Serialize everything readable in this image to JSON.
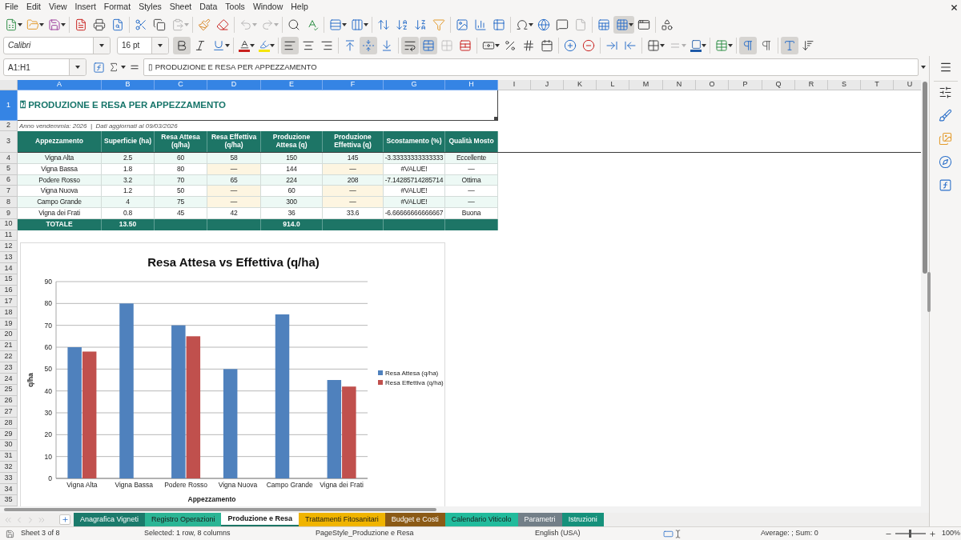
{
  "menu": [
    "File",
    "Edit",
    "View",
    "Insert",
    "Format",
    "Styles",
    "Sheet",
    "Data",
    "Tools",
    "Window",
    "Help"
  ],
  "toolbars": [
    {
      "groups": [
        [
          {
            "kind": "new",
            "dropdown": true,
            "pressed": false,
            "disabled": false
          },
          {
            "kind": "open",
            "dropdown": true,
            "pressed": false,
            "disabled": false
          },
          {
            "kind": "save",
            "dropdown": true,
            "pressed": false,
            "disabled": false
          }
        ],
        [
          {
            "kind": "export_pdf",
            "dropdown": false,
            "pressed": false,
            "disabled": false
          },
          {
            "kind": "print",
            "dropdown": false,
            "pressed": false,
            "disabled": false
          },
          {
            "kind": "print_preview",
            "dropdown": false,
            "pressed": false,
            "disabled": false
          }
        ],
        [
          {
            "kind": "cut",
            "dropdown": false,
            "pressed": false,
            "disabled": false
          },
          {
            "kind": "copy",
            "dropdown": false,
            "pressed": false,
            "disabled": false
          },
          {
            "kind": "paste",
            "dropdown": true,
            "pressed": false,
            "disabled": true
          }
        ],
        [
          {
            "kind": "clone_formatting",
            "dropdown": false,
            "pressed": false,
            "disabled": false
          },
          {
            "kind": "clear_formatting",
            "dropdown": false,
            "pressed": false,
            "disabled": false
          }
        ],
        [
          {
            "kind": "undo",
            "dropdown": true,
            "pressed": false,
            "disabled": true
          },
          {
            "kind": "redo",
            "dropdown": true,
            "pressed": false,
            "disabled": true
          }
        ],
        [
          {
            "kind": "find_replace",
            "dropdown": false,
            "pressed": false,
            "disabled": false
          },
          {
            "kind": "spelling",
            "dropdown": false,
            "pressed": false,
            "disabled": false
          }
        ],
        [
          {
            "kind": "row",
            "dropdown": true,
            "pressed": false,
            "disabled": false
          },
          {
            "kind": "column",
            "dropdown": true,
            "pressed": false,
            "disabled": false
          }
        ],
        [
          {
            "kind": "sort",
            "dropdown": false,
            "pressed": false,
            "disabled": false
          },
          {
            "kind": "sort_ascending",
            "dropdown": false,
            "pressed": false,
            "disabled": false
          },
          {
            "kind": "sort_descending",
            "dropdown": false,
            "pressed": false,
            "disabled": false
          },
          {
            "kind": "autofilter",
            "dropdown": false,
            "pressed": false,
            "disabled": false
          }
        ],
        [
          {
            "kind": "image",
            "dropdown": false,
            "pressed": false,
            "disabled": false
          },
          {
            "kind": "chart",
            "dropdown": false,
            "pressed": false,
            "disabled": false
          },
          {
            "kind": "pivot_table",
            "dropdown": false,
            "pressed": false,
            "disabled": false
          }
        ],
        [
          {
            "kind": "special_character",
            "dropdown": true,
            "pressed": false,
            "disabled": false
          },
          {
            "kind": "hyperlink",
            "dropdown": false,
            "pressed": false,
            "disabled": false
          },
          {
            "kind": "comment",
            "dropdown": false,
            "pressed": false,
            "disabled": false
          },
          {
            "kind": "header_footer",
            "dropdown": false,
            "pressed": false,
            "disabled": true
          }
        ],
        [
          {
            "kind": "print_area",
            "dropdown": false,
            "pressed": false,
            "disabled": false
          },
          {
            "kind": "freeze",
            "dropdown": true,
            "pressed": true,
            "disabled": false
          },
          {
            "kind": "split_window",
            "dropdown": false,
            "pressed": false,
            "disabled": false
          }
        ],
        [
          {
            "kind": "draw_functions",
            "dropdown": false,
            "pressed": false,
            "disabled": false
          }
        ]
      ]
    },
    {
      "font_name": "Calibri",
      "font_missing": true,
      "font_size": "16 pt",
      "groups": [
        [
          {
            "kind": "bold",
            "dropdown": false,
            "pressed": true,
            "disabled": false
          },
          {
            "kind": "italic",
            "dropdown": false,
            "pressed": false,
            "disabled": false
          },
          {
            "kind": "underline",
            "dropdown": true,
            "pressed": false,
            "disabled": false
          }
        ],
        [
          {
            "kind": "font_color",
            "dropdown": true,
            "pressed": false,
            "disabled": false
          },
          {
            "kind": "highlight",
            "dropdown": true,
            "pressed": false,
            "disabled": false
          }
        ],
        [
          {
            "kind": "align_left",
            "dropdown": false,
            "pressed": true,
            "disabled": false
          },
          {
            "kind": "align_center",
            "dropdown": false,
            "pressed": false,
            "disabled": false
          },
          {
            "kind": "align_right",
            "dropdown": false,
            "pressed": false,
            "disabled": false
          }
        ],
        [
          {
            "kind": "align_top",
            "dropdown": false,
            "pressed": false,
            "disabled": false
          },
          {
            "kind": "align_middle",
            "dropdown": false,
            "pressed": true,
            "disabled": false
          },
          {
            "kind": "align_bottom",
            "dropdown": false,
            "pressed": false,
            "disabled": false
          }
        ],
        [
          {
            "kind": "wrap_text",
            "dropdown": false,
            "pressed": true,
            "disabled": false
          },
          {
            "kind": "merge_center",
            "dropdown": false,
            "pressed": true,
            "disabled": false
          },
          {
            "kind": "merge_cells",
            "dropdown": false,
            "pressed": false,
            "disabled": true
          },
          {
            "kind": "unmerge_cells",
            "dropdown": false,
            "pressed": false,
            "disabled": false
          }
        ],
        [
          {
            "kind": "currency",
            "dropdown": true,
            "pressed": false,
            "disabled": false
          },
          {
            "kind": "percent",
            "dropdown": false,
            "pressed": false,
            "disabled": false
          },
          {
            "kind": "number",
            "dropdown": false,
            "pressed": false,
            "disabled": false
          },
          {
            "kind": "date",
            "dropdown": false,
            "pressed": false,
            "disabled": false
          }
        ],
        [
          {
            "kind": "add_decimal",
            "dropdown": false,
            "pressed": false,
            "disabled": false
          },
          {
            "kind": "delete_decimal",
            "dropdown": false,
            "pressed": false,
            "disabled": false
          }
        ],
        [
          {
            "kind": "indent",
            "dropdown": false,
            "pressed": false,
            "disabled": false
          },
          {
            "kind": "outdent",
            "dropdown": false,
            "pressed": false,
            "disabled": false
          }
        ],
        [
          {
            "kind": "borders",
            "dropdown": true,
            "pressed": false,
            "disabled": false
          },
          {
            "kind": "border_style",
            "dropdown": true,
            "pressed": false,
            "disabled": true
          },
          {
            "kind": "border_color",
            "dropdown": true,
            "pressed": false,
            "disabled": false
          }
        ],
        [
          {
            "kind": "conditional",
            "dropdown": true,
            "pressed": false,
            "disabled": false
          }
        ],
        [
          {
            "kind": "left_to_right",
            "dropdown": false,
            "pressed": true,
            "disabled": false
          },
          {
            "kind": "right_to_left",
            "dropdown": false,
            "pressed": false,
            "disabled": false
          }
        ],
        [
          {
            "kind": "text_orientation",
            "dropdown": false,
            "pressed": true,
            "disabled": false
          },
          {
            "kind": "vertical_text",
            "dropdown": false,
            "pressed": false,
            "disabled": false
          }
        ]
      ]
    }
  ],
  "formula_bar": {
    "name_box": "A1:H1",
    "formula": "▯ PRODUZIONE E RESA PER APPEZZAMENTO"
  },
  "sheet": {
    "columns": [
      {
        "label": "A",
        "selected": true
      },
      {
        "label": "B",
        "selected": true
      },
      {
        "label": "C",
        "selected": true
      },
      {
        "label": "D",
        "selected": true
      },
      {
        "label": "E",
        "selected": true
      },
      {
        "label": "F",
        "selected": true
      },
      {
        "label": "G",
        "selected": true
      },
      {
        "label": "H",
        "selected": true
      },
      {
        "label": "I",
        "selected": false
      },
      {
        "label": "J",
        "selected": false
      },
      {
        "label": "K",
        "selected": false
      },
      {
        "label": "L",
        "selected": false
      },
      {
        "label": "M",
        "selected": false
      },
      {
        "label": "N",
        "selected": false
      },
      {
        "label": "O",
        "selected": false
      },
      {
        "label": "P",
        "selected": false
      },
      {
        "label": "Q",
        "selected": false
      },
      {
        "label": "R",
        "selected": false
      },
      {
        "label": "S",
        "selected": false
      },
      {
        "label": "T",
        "selected": false
      },
      {
        "label": "U",
        "selected": false
      }
    ],
    "rows": [
      {
        "label": "1",
        "selected": true
      },
      {
        "label": "2",
        "selected": false
      },
      {
        "label": "3",
        "selected": false
      },
      {
        "label": "4",
        "selected": false
      },
      {
        "label": "5",
        "selected": false
      },
      {
        "label": "6",
        "selected": false
      },
      {
        "label": "7",
        "selected": false
      },
      {
        "label": "8",
        "selected": false
      },
      {
        "label": "9",
        "selected": false
      },
      {
        "label": "10",
        "selected": false
      },
      {
        "label": "11",
        "selected": false
      },
      {
        "label": "12",
        "selected": false
      },
      {
        "label": "13",
        "selected": false
      },
      {
        "label": "14",
        "selected": false
      },
      {
        "label": "15",
        "selected": false
      },
      {
        "label": "16",
        "selected": false
      },
      {
        "label": "17",
        "selected": false
      },
      {
        "label": "18",
        "selected": false
      },
      {
        "label": "19",
        "selected": false
      },
      {
        "label": "20",
        "selected": false
      },
      {
        "label": "21",
        "selected": false
      },
      {
        "label": "22",
        "selected": false
      },
      {
        "label": "23",
        "selected": false
      },
      {
        "label": "24",
        "selected": false
      },
      {
        "label": "25",
        "selected": false
      },
      {
        "label": "26",
        "selected": false
      },
      {
        "label": "27",
        "selected": false
      },
      {
        "label": "28",
        "selected": false
      },
      {
        "label": "29",
        "selected": false
      },
      {
        "label": "30",
        "selected": false
      },
      {
        "label": "31",
        "selected": false
      },
      {
        "label": "32",
        "selected": false
      },
      {
        "label": "33",
        "selected": false
      },
      {
        "label": "34",
        "selected": false
      },
      {
        "label": "35",
        "selected": false
      }
    ],
    "title": "⍰ PRODUZIONE E RESA PER APPEZZAMENTO",
    "subtitle": "Anno vendemmia: 2026  |  Dati aggiornati al 09/03/2026",
    "table": {
      "columns": [
        "Appezzamento",
        "Superficie (ha)",
        "Resa Attesa (q/ha)",
        "Resa Effettiva (q/ha)",
        "Produzione Attesa (q)",
        "Produzione Effettiva (q)",
        "Scostamento (%)",
        "Qualità Mosto"
      ],
      "rows": [
        {
          "cells": [
            "Vigna Alta",
            "2.5",
            "60",
            "58",
            "150",
            "145",
            "-3.33333333333333",
            "Eccellente"
          ],
          "pending": false
        },
        {
          "cells": [
            "Vigna Bassa",
            "1.8",
            "80",
            "—",
            "144",
            "—",
            "#VALUE!",
            "—"
          ],
          "pending": true
        },
        {
          "cells": [
            "Podere Rosso",
            "3.2",
            "70",
            "65",
            "224",
            "208",
            "-7.14285714285714",
            "Ottima"
          ],
          "pending": false
        },
        {
          "cells": [
            "Vigna Nuova",
            "1.2",
            "50",
            "—",
            "60",
            "—",
            "#VALUE!",
            "—"
          ],
          "pending": true
        },
        {
          "cells": [
            "Campo Grande",
            "4",
            "75",
            "—",
            "300",
            "—",
            "#VALUE!",
            "—"
          ],
          "pending": true
        },
        {
          "cells": [
            "Vigna dei Frati",
            "0.8",
            "45",
            "42",
            "36",
            "33.6",
            "-6.66666666666667",
            "Buona"
          ],
          "pending": false
        }
      ],
      "total": {
        "label": "TOTALE",
        "superficie": "13.50",
        "produzione_attesa": "914.0"
      }
    },
    "chart": {
      "chart_data": {
        "type": "bar",
        "title": "Resa Attesa vs Effettiva (q/ha)",
        "xlabel": "Appezzamento",
        "ylabel": "q/ha",
        "categories": [
          "Vigna Alta",
          "Vigna Bassa",
          "Podere Rosso",
          "Vigna Nuova",
          "Campo Grande",
          "Vigna dei Frati"
        ],
        "series": [
          {
            "name": "Resa Attesa (q/ha)",
            "color": "#4f81bd",
            "values": [
              60,
              80,
              70,
              50,
              75,
              45
            ]
          },
          {
            "name": "Resa Effettiva (q/ha)",
            "color": "#c0504d",
            "values": [
              58,
              null,
              65,
              null,
              null,
              42
            ]
          }
        ],
        "ylim": [
          0,
          90
        ],
        "yticks": [
          {
            "value": 0,
            "label": "0"
          },
          {
            "value": 10,
            "label": "10"
          },
          {
            "value": 20,
            "label": "20"
          },
          {
            "value": 30,
            "label": "30"
          },
          {
            "value": 40,
            "label": "40"
          },
          {
            "value": 50,
            "label": "50"
          },
          {
            "value": 60,
            "label": "60"
          },
          {
            "value": 70,
            "label": "70"
          },
          {
            "value": 80,
            "label": "80"
          },
          {
            "value": 90,
            "label": "90"
          }
        ],
        "grid": true,
        "legend": true,
        "orientation": "vertical",
        "stacked": false
      }
    }
  },
  "sheet_navigation": {
    "disabled": true
  },
  "sheet_tabs": [
    {
      "label": "Anagrafica Vigneti",
      "selected": false,
      "color": "#1b7a6b"
    },
    {
      "label": "Registro Operazioni",
      "selected": false,
      "color": "#2bb595"
    },
    {
      "label": "Produzione e Resa",
      "selected": true
    },
    {
      "label": "Trattamenti Fitosanitari",
      "selected": false,
      "color": "#f0b400"
    },
    {
      "label": "Budget e Costi",
      "selected": false,
      "color": "#8b5a16"
    },
    {
      "label": "Calendario Viticolo",
      "selected": false,
      "color": "#22bb9c"
    },
    {
      "label": "Parametri",
      "selected": false,
      "color": "#737f88"
    },
    {
      "label": "Istruzioni",
      "selected": false,
      "color": "#16917b"
    }
  ],
  "status_bar": {
    "sheet": "Sheet 3 of 8",
    "selection": "Selected: 1 row, 8 columns",
    "page_style": "PageStyle_Produzione e Resa",
    "language": "English (USA)",
    "summary": "Average: ; Sum: 0",
    "zoom": {
      "level": 0.45,
      "value": "100%"
    }
  }
}
